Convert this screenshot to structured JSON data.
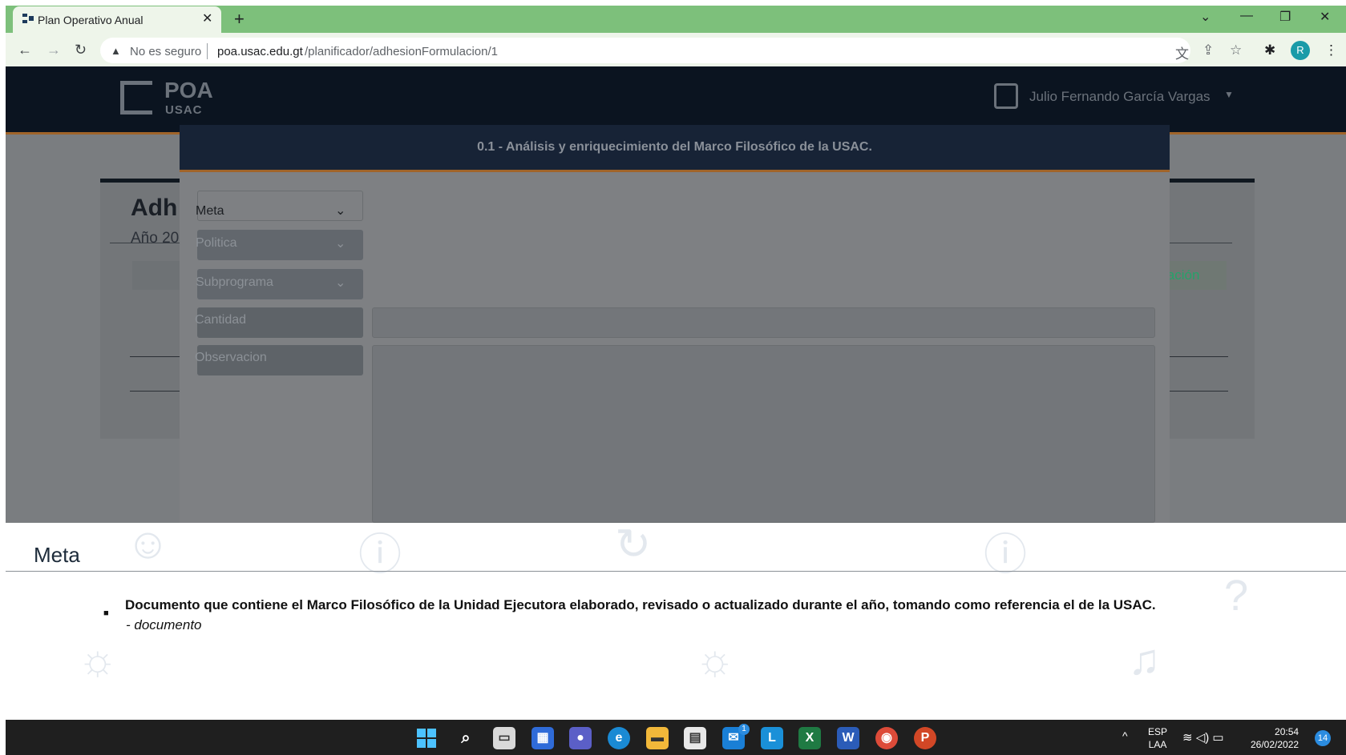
{
  "browser": {
    "tab_title": "Plan Operativo Anual",
    "tab_close": "✕",
    "new_tab": "+",
    "security": "No es seguro",
    "url_host": "poa.usac.edu.gt",
    "url_path": "/planificador/adhesionFormulacion/1",
    "profile_initial": "R"
  },
  "header": {
    "logo_text": "POA",
    "logo_sub": "USAC",
    "user_name": "Julio Fernando García Vargas"
  },
  "background_page": {
    "title": "Adh",
    "year_text": "Año 20",
    "right_button": "lación"
  },
  "modal": {
    "title": "0.1 - Análisis y enriquecimiento del Marco Filosófico de la USAC.",
    "selects": [
      "Meta",
      "Politica",
      "Subprograma"
    ],
    "fields": [
      "Cantidad",
      "Observacion"
    ]
  },
  "detail": {
    "heading": "Meta",
    "item_text": "Documento que contiene el Marco Filosófico de la Unidad Ejecutora elaborado, revisado o actualizado durante el año, tomando como referencia el de la USAC.",
    "item_unit": "- documento"
  },
  "taskbar": {
    "lang_top": "ESP",
    "lang_bottom": "LAA",
    "time": "20:54",
    "date": "26/02/2022",
    "notifications": "14",
    "mail_badge": "1"
  },
  "colors": {
    "chrome_green": "#7dc07b",
    "nav_dark": "#0b1420",
    "accent_orange": "#a0642a",
    "modal_header": "#172336"
  }
}
